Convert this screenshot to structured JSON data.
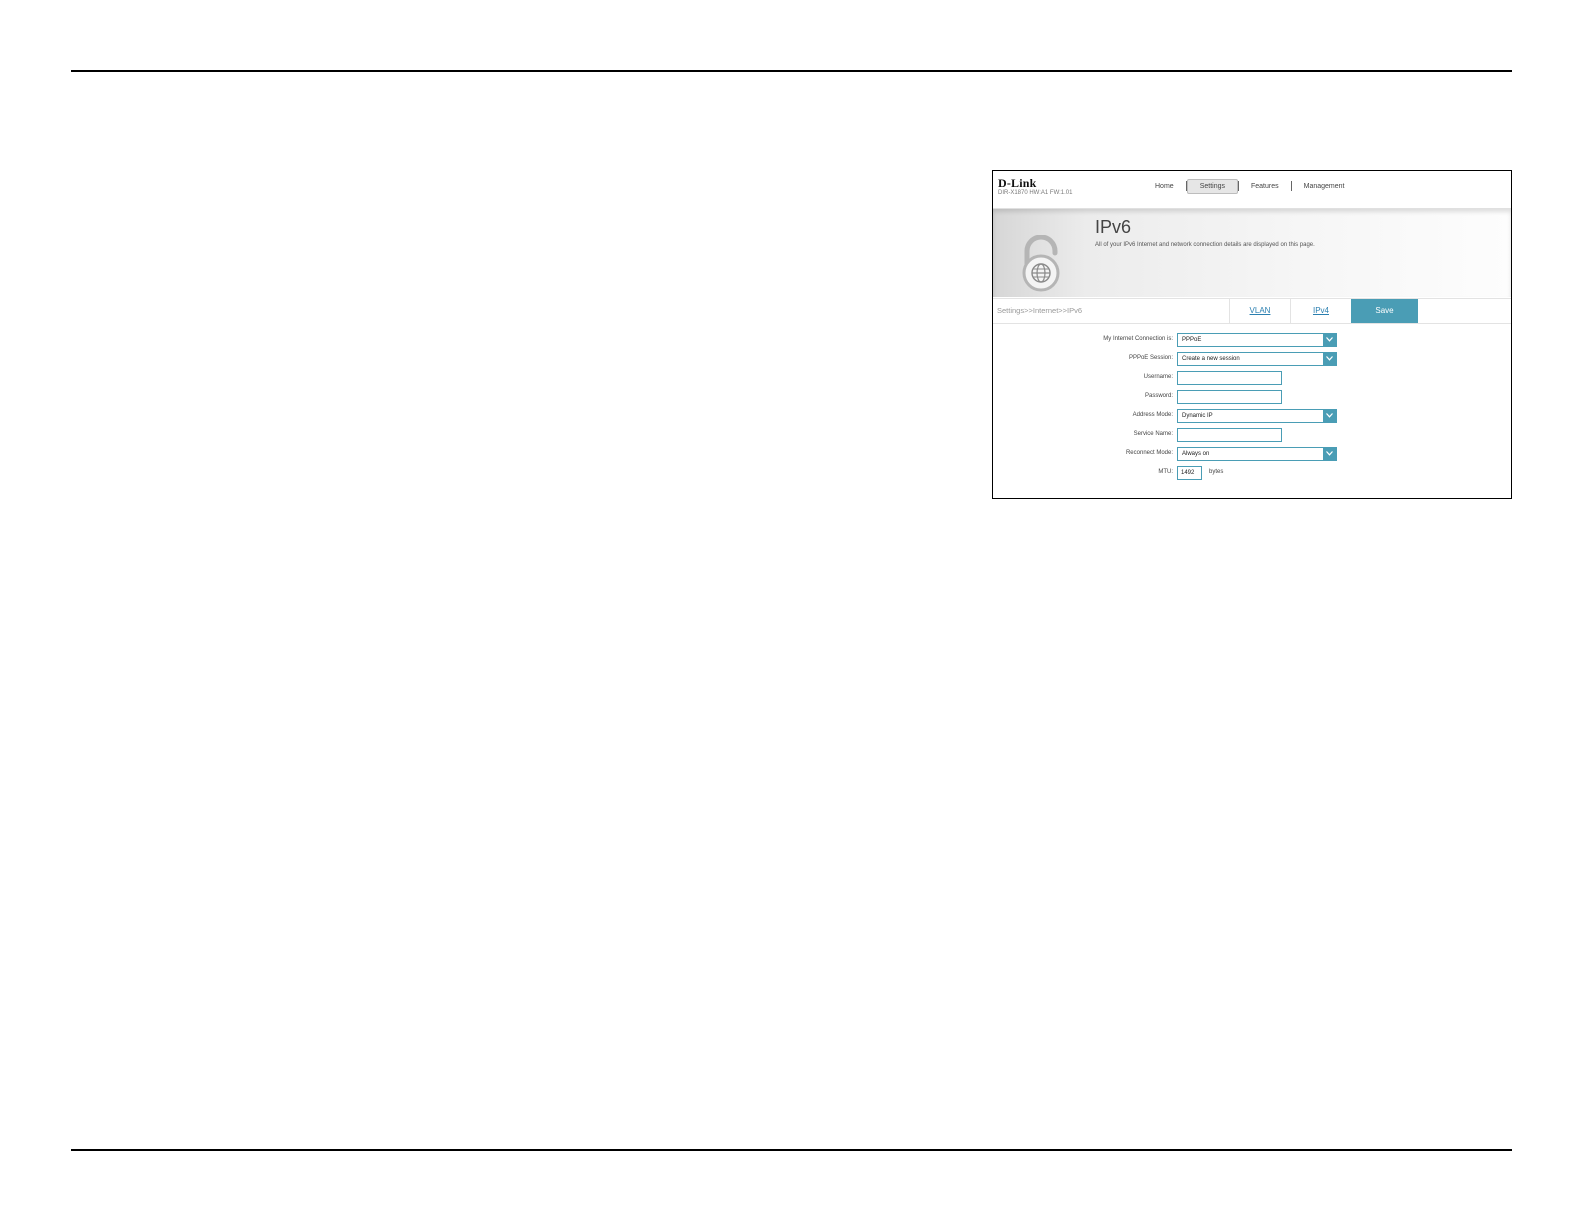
{
  "brand": {
    "logo": "D-Link",
    "model": "DIR-X1870 HW:A1 FW:1.01"
  },
  "nav": {
    "items": [
      "Home",
      "Settings",
      "Features",
      "Management"
    ],
    "active": "Settings"
  },
  "hero": {
    "title": "IPv6",
    "description": "All of your IPv6 Internet and network connection details are displayed on this page."
  },
  "breadcrumb": "Settings>>Internet>>IPv6",
  "tabs": {
    "vlan": "VLAN",
    "ipv4": "IPv4",
    "save": "Save"
  },
  "form": {
    "connection": {
      "label": "My Internet Connection is:",
      "value": "PPPoE"
    },
    "session": {
      "label": "PPPoE Session:",
      "value": "Create a new session"
    },
    "username": {
      "label": "Username:",
      "value": ""
    },
    "password": {
      "label": "Password:",
      "value": ""
    },
    "address_mode": {
      "label": "Address Mode:",
      "value": "Dynamic IP"
    },
    "service_name": {
      "label": "Service Name:",
      "value": ""
    },
    "reconnect_mode": {
      "label": "Reconnect Mode:",
      "value": "Always on"
    },
    "mtu": {
      "label": "MTU:",
      "value": "1492",
      "unit": "bytes"
    }
  },
  "colors": {
    "accent": "#4a9db5",
    "link": "#2a7fb0"
  }
}
